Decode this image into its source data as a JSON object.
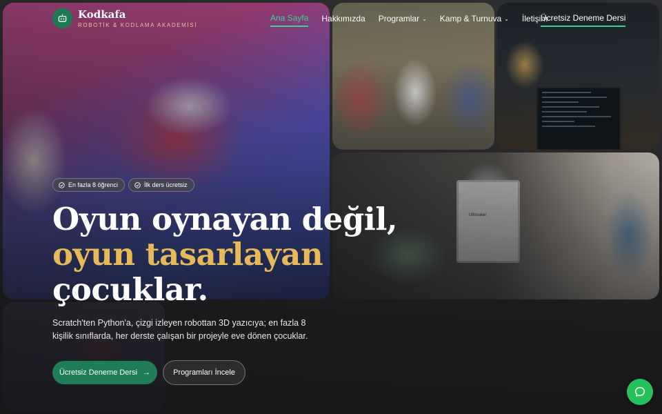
{
  "brand": {
    "name": "Kodkafa",
    "tagline": "ROBOTİK & KODLAMA AKADEMİSİ"
  },
  "nav": {
    "items": [
      {
        "label": "Ana Sayfa",
        "active": true
      },
      {
        "label": "Hakkımızda"
      },
      {
        "label": "Programlar",
        "dropdown": true
      },
      {
        "label": "Kamp & Turnuva",
        "dropdown": true
      },
      {
        "label": "İletişim"
      }
    ],
    "cta": "Ücretsiz Deneme Dersi"
  },
  "hero": {
    "badges": [
      "En fazla 8 öğrenci",
      "İlk ders ücretsiz"
    ],
    "headline": {
      "part1": "Oyun oynayan değil, ",
      "highlight": "oyun tasarlayan",
      "part2": " çocuklar."
    },
    "lede": "Scratch'ten Python'a, çizgi izleyen robottan 3D yazıcıya; en fazla 8 kişilik sınıflarda, her derste çalışan bir projeyle eve dönen çocuklar.",
    "primary_button": "Ücretsiz Deneme Dersi",
    "secondary_button": "Programları İncele"
  },
  "photos": {
    "printer_label": "Ultimaker"
  },
  "colors": {
    "accent_green": "#1f7e57",
    "nav_active": "#3bd18f",
    "highlight_gold": "#e7b958",
    "tagline_gold": "#e4c79b",
    "chat_green": "#25c35c"
  },
  "icons": {
    "logo": "robot-icon",
    "badge": "check-circle-icon",
    "button_arrow": "arrow-right-icon",
    "chat": "chat-bubble-icon",
    "dropdown": "chevron-down-icon"
  }
}
